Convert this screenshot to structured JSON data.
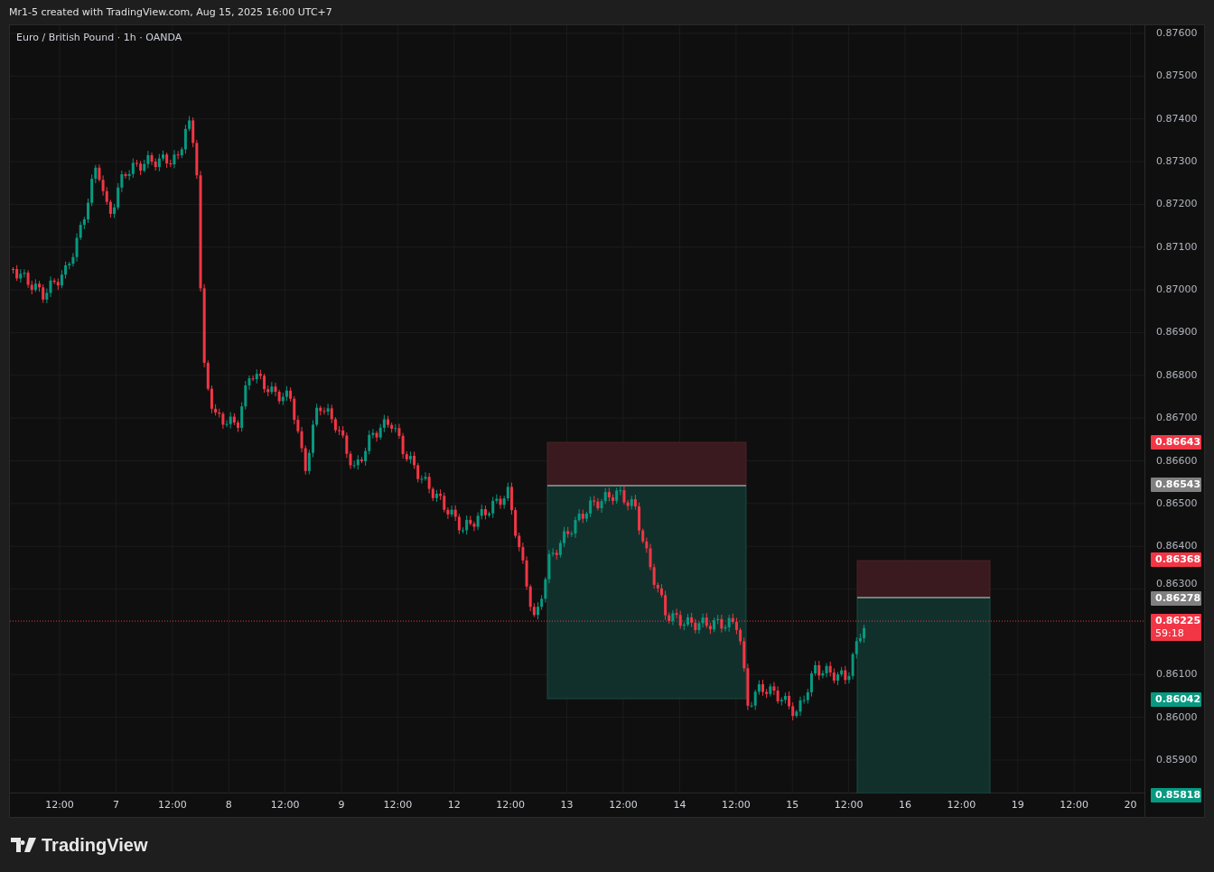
{
  "header": {
    "attribution": "Mr1-5 created with TradingView.com, Aug 15, 2025 16:00 UTC+7"
  },
  "chart": {
    "title": "Euro / British Pound · 1h · OANDA",
    "price_ticks": [
      "0.87600",
      "0.87500",
      "0.87400",
      "0.87300",
      "0.87200",
      "0.87100",
      "0.87000",
      "0.86900",
      "0.86800",
      "0.86700",
      "0.86600",
      "0.86500",
      "0.86400",
      "0.86300",
      "0.86100",
      "0.86000",
      "0.85900"
    ],
    "price_labels": [
      {
        "text": "0.86643",
        "color": "#f23645"
      },
      {
        "text": "0.86543",
        "color": "#808080"
      },
      {
        "text": "0.86368",
        "color": "#f23645"
      },
      {
        "text": "0.86278",
        "color": "#808080"
      },
      {
        "text": "0.86225",
        "countdown": "59:18",
        "color": "#f23645"
      },
      {
        "text": "0.86042",
        "color": "#089981"
      },
      {
        "text": "0.85818",
        "color": "#089981"
      }
    ],
    "time_labels": [
      "12:00",
      "7",
      "12:00",
      "8",
      "12:00",
      "9",
      "12:00",
      "12",
      "12:00",
      "13",
      "12:00",
      "14",
      "12:00",
      "15",
      "12:00",
      "16",
      "12:00",
      "19",
      "12:00",
      "20"
    ]
  },
  "footer": {
    "brand": "TradingView"
  }
}
